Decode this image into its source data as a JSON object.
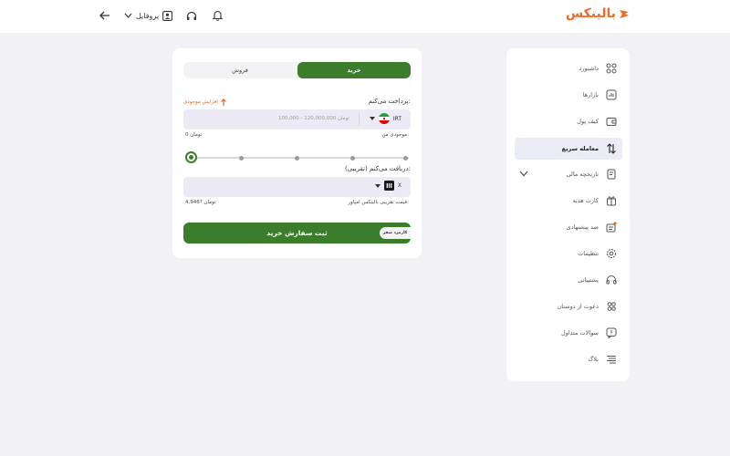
{
  "header": {
    "brand": "بالینکس",
    "profile_label": "پروفایل",
    "icons": [
      "logout-arrow-icon",
      "chevron-down-icon",
      "profile-icon",
      "headphones-icon",
      "bell-icon"
    ]
  },
  "sidebar": {
    "items": [
      {
        "label": "داشبورد",
        "icon": "dashboard-icon"
      },
      {
        "label": "بازارها",
        "icon": "markets-icon"
      },
      {
        "label": "کیف پول",
        "icon": "wallet-icon"
      },
      {
        "label": "معامله سریع",
        "icon": "swap-icon",
        "active": true
      },
      {
        "label": "تاریخچه مالی",
        "icon": "history-icon"
      },
      {
        "label": "کارت هدیه",
        "icon": "gift-card-icon"
      },
      {
        "label": "صد پیشنهادی",
        "icon": "offer-icon"
      },
      {
        "label": "تنظیمات",
        "icon": "settings-icon"
      },
      {
        "label": "پشتیبانی",
        "icon": "support-icon"
      },
      {
        "label": "دعوت از دوستان",
        "icon": "invite-icon"
      },
      {
        "label": "سوالات متداول",
        "icon": "faq-icon"
      },
      {
        "label": "بلاگ",
        "icon": "blog-icon"
      }
    ]
  },
  "trade": {
    "tabs": {
      "buy": "خرید",
      "sell": "فروش"
    },
    "pay": {
      "label": "پرداخت می‌کنم:",
      "boost": "افزایش موجودی",
      "placeholder": "100,000 - 120,000,000 تومان",
      "currency": "IRT",
      "balance_label": "موجودی من:",
      "balance_value": "0 تومان"
    },
    "slider_steps": 5,
    "slider_value": 0,
    "receive": {
      "label": "دریافت می‌کنم (تقریبی):",
      "currency": "X",
      "price_label": "قیمت تقریبی بالینکس امپاور:",
      "price_value": "4,946? تومان"
    },
    "submit_label": "ثبت سفارش خرید",
    "zero_fee": "کارمزد صفر"
  },
  "colors": {
    "primary": "#3b7d2b",
    "brand": "#f26b22",
    "field": "#ecebf5",
    "page": "#f2f2f6"
  }
}
